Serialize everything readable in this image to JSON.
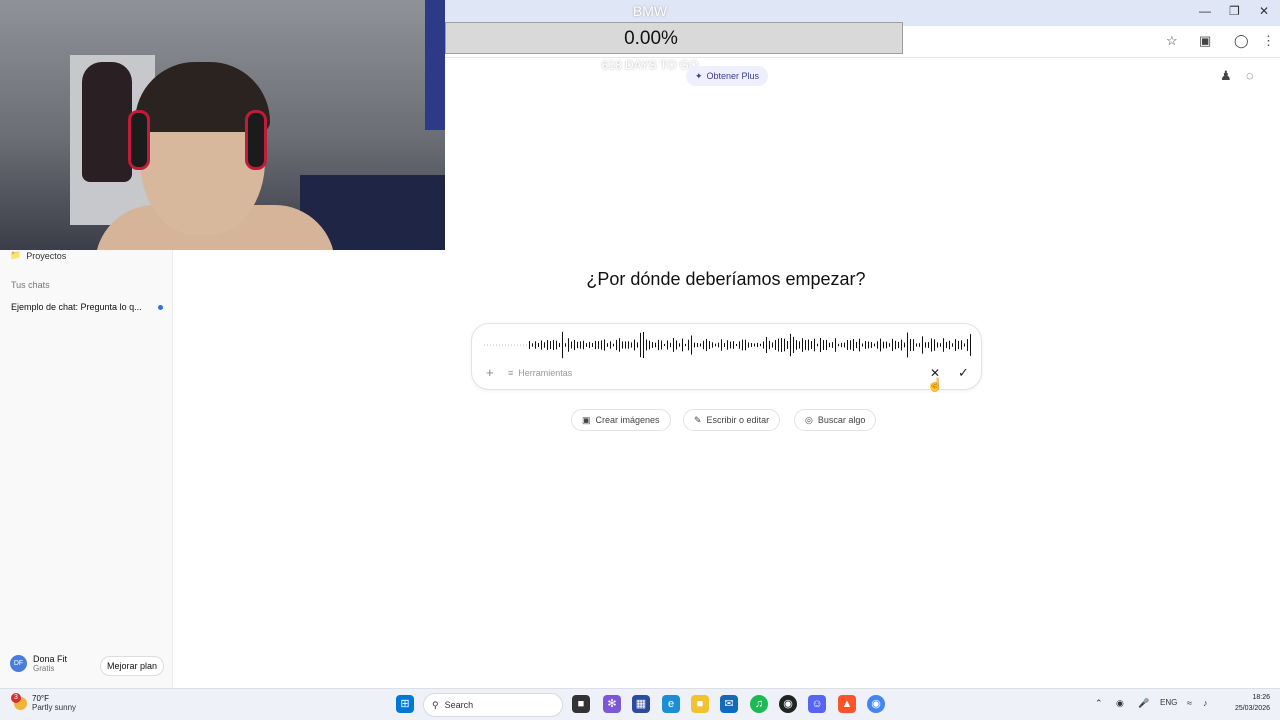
{
  "overlay": {
    "title": "BMW",
    "percent": "0.00%",
    "countdown": "618 DAYS TO GO"
  },
  "browser": {
    "icons": [
      "star-icon",
      "extension-icon",
      "profile-icon",
      "kebab-menu-icon"
    ],
    "window_controls": [
      "minimize",
      "restore",
      "close"
    ]
  },
  "header": {
    "plus_label": "Obtener Plus"
  },
  "sidebar": {
    "projects_label": "Proyectos",
    "chats_heading": "Tus chats",
    "chats": [
      {
        "title": "Ejemplo de chat: Pregunta lo q..."
      }
    ],
    "user": {
      "initials": "DF",
      "name": "Dona Fit",
      "plan": "Gratis",
      "upgrade_label": "Mejorar plan"
    }
  },
  "main": {
    "headline": "¿Por dónde deberíamos empezar?",
    "composer": {
      "tools_label": "Herramientas",
      "recording": true
    },
    "suggestions": [
      {
        "label": "Crear imágenes",
        "icon": "image-icon"
      },
      {
        "label": "Escribir o editar",
        "icon": "pencil-icon"
      },
      {
        "label": "Buscar algo",
        "icon": "globe-icon"
      }
    ]
  },
  "taskbar": {
    "weather": {
      "temp": "70°F",
      "condition": "Partly sunny",
      "badge": "3"
    },
    "search_placeholder": "Search",
    "language": "ENG",
    "time": "18:26",
    "date": "25/03/2026",
    "colors": {
      "start": "#0078d4",
      "spotify": "#1db954",
      "brave": "#fb542b",
      "discord": "#5865f2",
      "chrome": "#4285f4"
    }
  }
}
